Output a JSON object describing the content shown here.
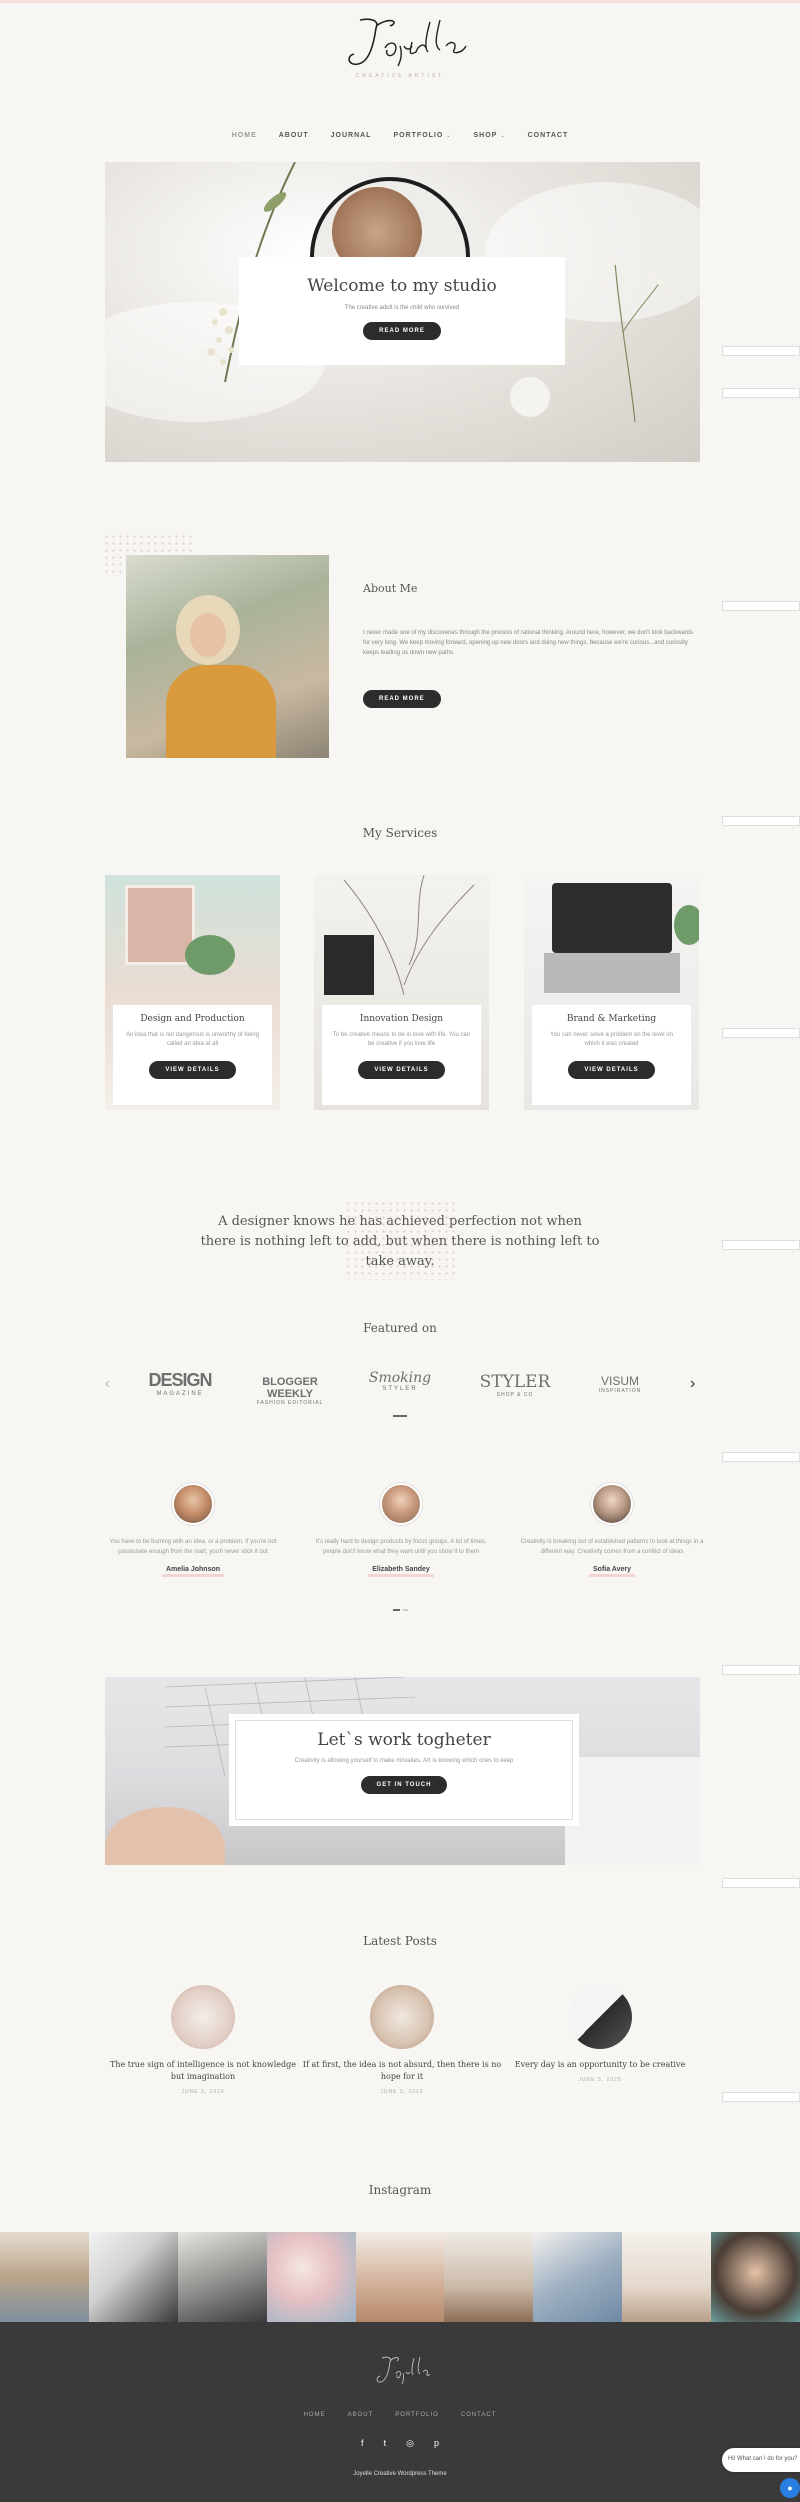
{
  "brand": {
    "logo_text": "Joyelle",
    "tagline": "CREATIVE ARTIST"
  },
  "nav": {
    "items": [
      {
        "label": "HOME"
      },
      {
        "label": "ABOUT"
      },
      {
        "label": "JOURNAL"
      },
      {
        "label": "PORTFOLIO"
      },
      {
        "label": "SHOP"
      },
      {
        "label": "CONTACT"
      }
    ]
  },
  "hero": {
    "title": "Welcome to my studio",
    "subtitle": "The creative adult is the child who survived",
    "button": "READ MORE"
  },
  "about": {
    "title": "About Me",
    "text": "I never made one of my discoveries through the process of rational thinking. Around here, however, we don't look backwards for very long. We keep moving forward, opening up new doors and doing new things, because we're curious...and curiosity keeps leading us down new paths.",
    "button": "READ MORE"
  },
  "services": {
    "title": "My Services",
    "items": [
      {
        "title": "Design and Production",
        "text": "An idea that is not dangerous is unworthy of being called an idea at all",
        "button": "VIEW DETAILS"
      },
      {
        "title": "Innovation Design",
        "text": "To be creative means to be in love with life. You can be creative if you love life",
        "button": "VIEW DETAILS"
      },
      {
        "title": "Brand & Marketing",
        "text": "You can never solve a problem on the level on which it was created",
        "button": "VIEW DETAILS"
      }
    ]
  },
  "quote": {
    "text": "A designer knows he has achieved perfection not when there is nothing left to add, but when there is nothing left to take away."
  },
  "featured": {
    "title": "Featured on",
    "logos": [
      {
        "main": "DESIGN",
        "sub": "MAGAZINE"
      },
      {
        "main": "BLOGGER WEEKLY",
        "sub": "FASHION EDITORIAL"
      },
      {
        "main": "Smoking",
        "sub": "STYLER"
      },
      {
        "main": "STYLER",
        "sub": "SHOP & CO"
      },
      {
        "main": "VISUM",
        "sub": "INSPIRATION"
      }
    ]
  },
  "testimonials": [
    {
      "text": "You have to be burning with an idea, or a problem. If you're not passionate enough from the start, you'll never stick it out",
      "name": "Amelia Johnson"
    },
    {
      "text": "It's really hard to design products by focus groups. A lot of times, people don't know what they want until you show it to them",
      "name": "Elizabeth Sandey"
    },
    {
      "text": "Creativity is breaking out of established patterns to look at things in a different way. Creativity comes from a conflict of ideas",
      "name": "Sofia Avery"
    }
  ],
  "cta": {
    "title": "Let`s work togheter",
    "text": "Creativity is allowing yourself to make mistakes. Art is knowing which ones to keep",
    "button": "GET IN TOUCH"
  },
  "posts": {
    "title": "Latest Posts",
    "items": [
      {
        "title": "The true sign of intelligence is not knowledge but imagination",
        "date": "JUNE 3, 2020"
      },
      {
        "title": "If at first, the idea is not absurd, then there is no hope for it",
        "date": "JUNE 3, 2020"
      },
      {
        "title": "Every day is an opportunity to be creative",
        "date": "JUNE 3, 2020"
      }
    ]
  },
  "instagram": {
    "title": "Instagram"
  },
  "footer": {
    "logo_text": "Joyelle",
    "nav": [
      {
        "label": "HOME"
      },
      {
        "label": "ABOUT"
      },
      {
        "label": "PORTFOLIO"
      },
      {
        "label": "CONTACT"
      }
    ],
    "social": [
      "f",
      "t",
      "◎",
      "p"
    ],
    "copyright": "Joyelle Creative Wordpress Theme"
  },
  "chat": {
    "text": "Hi! What can I do for you?"
  },
  "colors": {
    "accent": "#f0d6d2",
    "dark": "#2c2c2c",
    "footer": "#3a3a3a",
    "background": "#f8f6f3"
  }
}
